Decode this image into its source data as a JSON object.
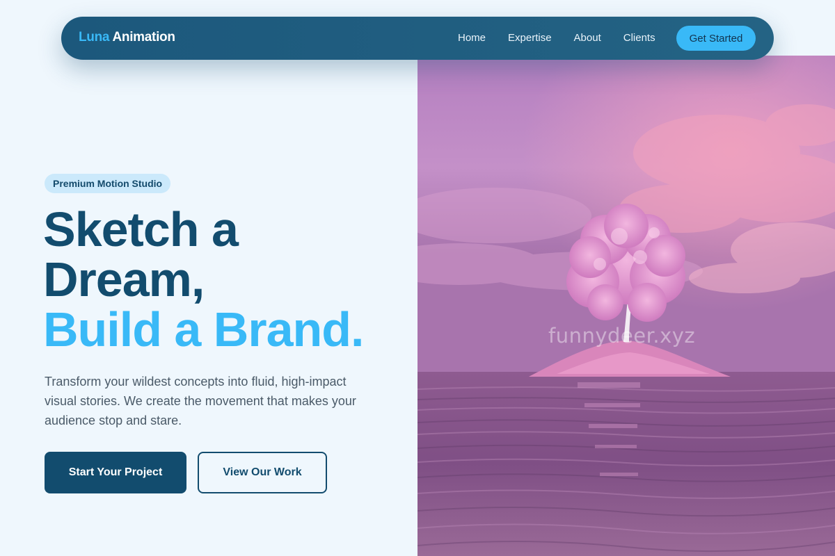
{
  "brand": {
    "name_accent": "Luna",
    "name_rest": "Animation"
  },
  "nav": {
    "links": [
      "Home",
      "Expertise",
      "About",
      "Clients"
    ],
    "cta_label": "Get Started"
  },
  "hero": {
    "badge": "Premium Motion Studio",
    "headline_line1": "Sketch a",
    "headline_line2": "Dream,",
    "headline_highlight": "Build a Brand.",
    "description": "Transform your wildest concepts into fluid, high-impact visual stories. We create the movement that makes your audience stop and stare.",
    "primary_button": "Start Your Project",
    "secondary_button": "View Our Work"
  },
  "image": {
    "subject": "pink-tree-island-at-sunset",
    "watermark": "funnydeer.xyz"
  },
  "colors": {
    "navy": "#124c6e",
    "accent": "#39b9f7",
    "background": "#eff7fd",
    "badge_bg": "#cbe9fb"
  }
}
